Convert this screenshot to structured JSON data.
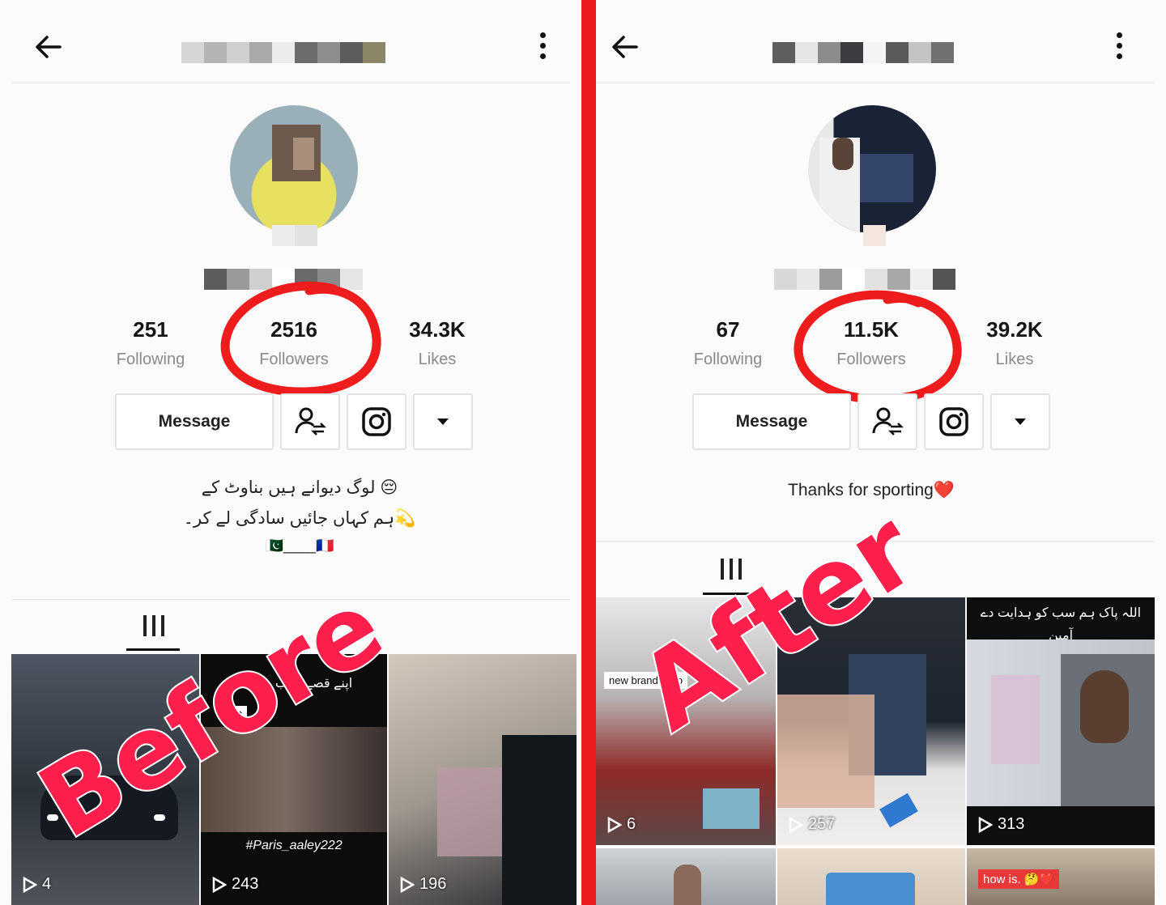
{
  "colors": {
    "accent_red": "#ee1c1c",
    "stamp_pink": "#ff1f4c"
  },
  "before": {
    "stamp": "Before",
    "stats": [
      {
        "value": "251",
        "label": "Following"
      },
      {
        "value": "2516",
        "label": "Followers"
      },
      {
        "value": "34.3K",
        "label": "Likes"
      }
    ],
    "message_label": "Message",
    "bio_line1": "لوگ دیوانے ہیں بناوٹ کے 😔",
    "bio_line2": "ہم کہاں جائیں سادگی لے کر۔💫",
    "bio_line3": "🇵🇰____🇫🇷",
    "tiles": [
      {
        "views": "4"
      },
      {
        "views": "243",
        "overlay": "اپنے قصے کتاب ہو گا",
        "badge": "ast",
        "caption": "#Paris_aaley222"
      },
      {
        "views": "196"
      }
    ]
  },
  "after": {
    "stamp": "After",
    "stats": [
      {
        "value": "67",
        "label": "Following"
      },
      {
        "value": "11.5K",
        "label": "Followers"
      },
      {
        "value": "39.2K",
        "label": "Likes"
      }
    ],
    "message_label": "Message",
    "bio": "Thanks for sporting❤️",
    "tiles": [
      {
        "views": "6",
        "caption": "new brand is co"
      },
      {
        "views": "257"
      },
      {
        "views": "313",
        "overlay": "اللہ پاک ہم سب کو ہدایت دے آمین"
      },
      {
        "caption": "how is. 🤔❤️"
      }
    ]
  },
  "icons": [
    "back-arrow-icon",
    "more-vertical-icon",
    "add-friend-icon",
    "instagram-icon",
    "dropdown-caret-icon",
    "grid-icon",
    "play-icon"
  ]
}
